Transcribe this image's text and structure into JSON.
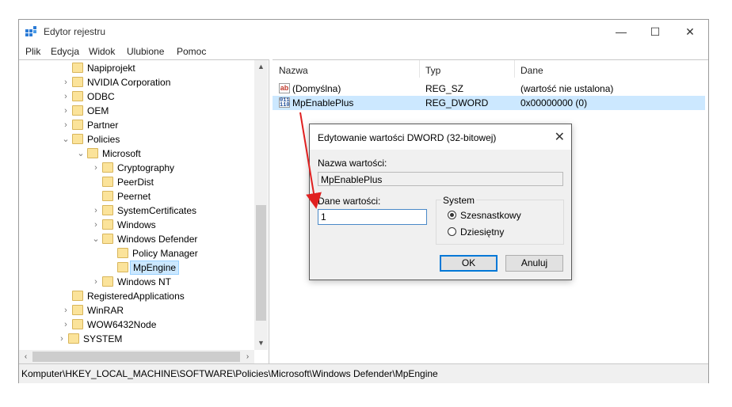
{
  "window": {
    "title": "Edytor rejestru",
    "controls": {
      "minimize": "—",
      "maximize": "☐",
      "close": "✕"
    }
  },
  "menu": [
    "Plik",
    "Edycja",
    "Widok",
    "Ulubione",
    "Pomoc"
  ],
  "tree": [
    {
      "label": "Napiprojekt",
      "level": 1,
      "expander": ""
    },
    {
      "label": "NVIDIA Corporation",
      "level": 1,
      "expander": "›"
    },
    {
      "label": "ODBC",
      "level": 1,
      "expander": "›"
    },
    {
      "label": "OEM",
      "level": 1,
      "expander": "›"
    },
    {
      "label": "Partner",
      "level": 1,
      "expander": "›"
    },
    {
      "label": "Policies",
      "level": 1,
      "expander": "⌄"
    },
    {
      "label": "Microsoft",
      "level": 2,
      "expander": "⌄"
    },
    {
      "label": "Cryptography",
      "level": 3,
      "expander": "›"
    },
    {
      "label": "PeerDist",
      "level": 3,
      "expander": ""
    },
    {
      "label": "Peernet",
      "level": 3,
      "expander": ""
    },
    {
      "label": "SystemCertificates",
      "level": 3,
      "expander": "›"
    },
    {
      "label": "Windows",
      "level": 3,
      "expander": "›"
    },
    {
      "label": "Windows Defender",
      "level": 3,
      "expander": "⌄"
    },
    {
      "label": "Policy Manager",
      "level": 4,
      "expander": ""
    },
    {
      "label": "MpEngine",
      "level": 4,
      "expander": "",
      "selected": true
    },
    {
      "label": "Windows NT",
      "level": 3,
      "expander": "›"
    },
    {
      "label": "RegisteredApplications",
      "level": 1,
      "expander": ""
    },
    {
      "label": "WinRAR",
      "level": 1,
      "expander": "›"
    },
    {
      "label": "WOW6432Node",
      "level": 1,
      "expander": "›"
    },
    {
      "label": "SYSTEM",
      "level": 0,
      "expander": "›"
    }
  ],
  "list": {
    "headers": {
      "name": "Nazwa",
      "type": "Typ",
      "data": "Dane"
    },
    "rows": [
      {
        "icon": "string-value-icon",
        "icon_text": "ab",
        "name": "(Domyślna)",
        "type": "REG_SZ",
        "data": "(wartość nie ustalona)"
      },
      {
        "icon": "binary-value-icon",
        "icon_text": "011 110",
        "name": "MpEnablePlus",
        "type": "REG_DWORD",
        "data": "0x00000000 (0)"
      }
    ]
  },
  "status": "Komputer\\HKEY_LOCAL_MACHINE\\SOFTWARE\\Policies\\Microsoft\\Windows Defender\\MpEngine",
  "dialog": {
    "title": "Edytowanie wartości DWORD (32-bitowej)",
    "close": "✕",
    "name_label": "Nazwa wartości:",
    "name_value": "MpEnablePlus",
    "data_label": "Dane wartości:",
    "data_value": "1",
    "system_label": "System",
    "radio_hex": "Szesnastkowy",
    "radio_dec": "Dziesiętny",
    "selected_base": "hex",
    "ok": "OK",
    "cancel": "Anuluj"
  },
  "annotation": {
    "arrow_color": "#e02020"
  }
}
